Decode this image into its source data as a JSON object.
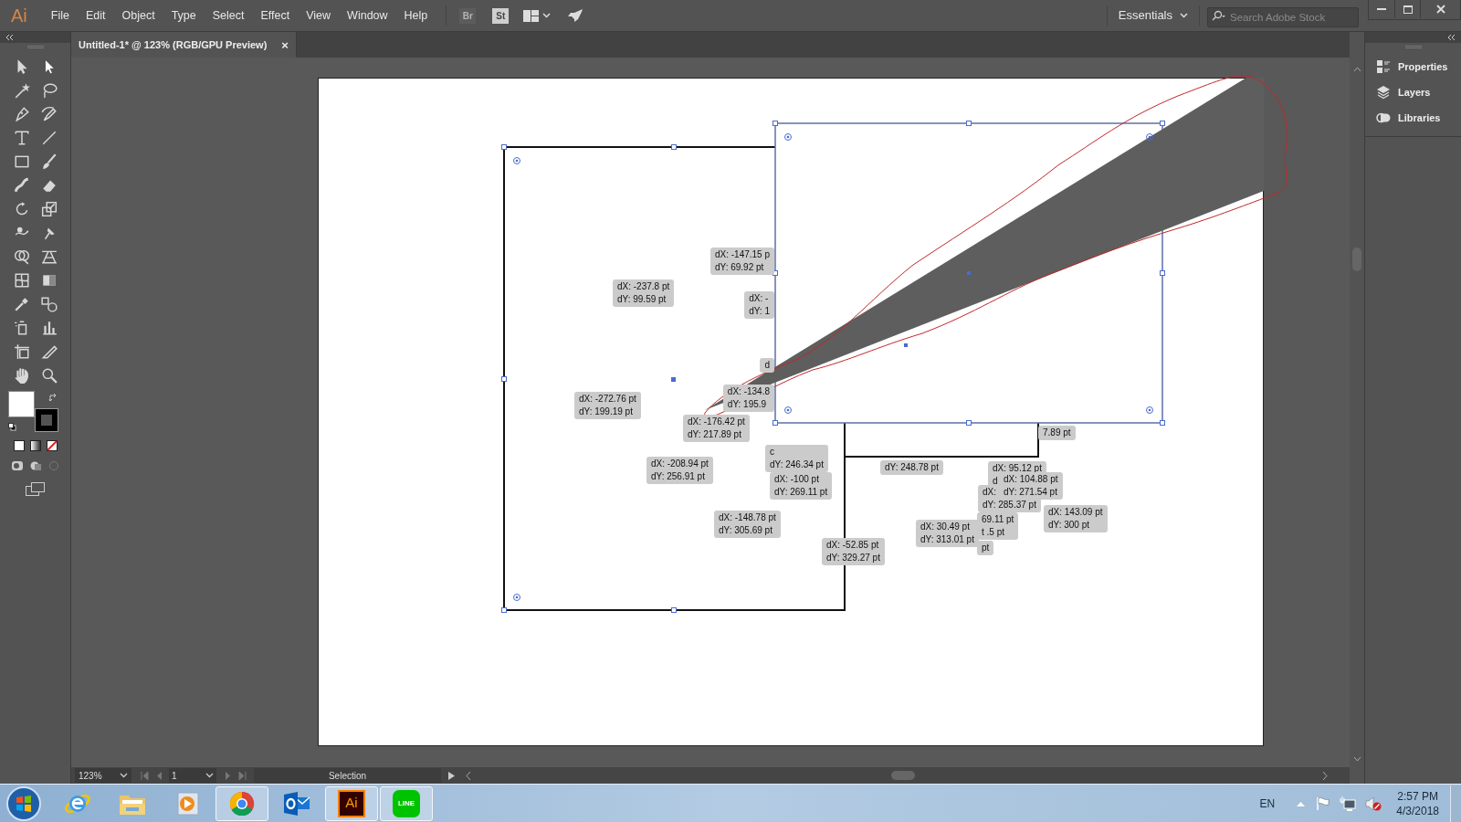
{
  "app": {
    "logo": "Ai"
  },
  "menu": [
    "File",
    "Edit",
    "Object",
    "Type",
    "Select",
    "Effect",
    "View",
    "Window",
    "Help"
  ],
  "app_buttons": [
    {
      "label": "Br",
      "disabled": true
    },
    {
      "label": "St",
      "disabled": false
    }
  ],
  "workspace": "Essentials",
  "search": {
    "placeholder": "Search Adobe Stock"
  },
  "document_tab": {
    "title": "Untitled-1* @ 123% (RGB/GPU Preview)",
    "close": "×"
  },
  "panels": [
    {
      "kind": "properties",
      "label": "Properties"
    },
    {
      "kind": "layers",
      "label": "Layers"
    },
    {
      "kind": "libraries",
      "label": "Libraries"
    }
  ],
  "tooltips": [
    {
      "lines": [
        "dX: -147.15 p",
        "dY: 69.92 pt"
      ]
    },
    {
      "lines": [
        "dX: -237.8 pt",
        "dY: 99.59 pt"
      ]
    },
    {
      "lines": [
        "dX: -",
        "dY: 1"
      ]
    },
    {
      "lines": [
        "d"
      ]
    },
    {
      "lines": [
        "dX: -272.76 pt",
        "dY: 199.19 pt"
      ]
    },
    {
      "lines": [
        "dX: -134.8",
        "dY: 195.9"
      ]
    },
    {
      "lines": [
        "dX: -176.42 pt",
        "dY: 217.89 pt"
      ]
    },
    {
      "lines": [
        "dX: -208.94 pt",
        "dY: 256.91 pt"
      ]
    },
    {
      "lines": [
        "c",
        "dY: 246.34 pt"
      ]
    },
    {
      "lines": [
        "dX: -100 pt",
        "dY: 269.11 pt"
      ]
    },
    {
      "lines": [
        "dX: -148.78 pt",
        "dY: 305.69 pt"
      ]
    },
    {
      "lines": [
        "dX: -52.85 pt",
        "dY: 329.27 pt"
      ]
    },
    {
      "lines": [
        "7.89 pt"
      ]
    },
    {
      "lines": [
        "dY: 248.78 pt"
      ]
    },
    {
      "lines": [
        "dX: 95.12 pt",
        "d"
      ]
    },
    {
      "lines": [
        "dX: 104.88 pt",
        "dY: 271.54 pt"
      ]
    },
    {
      "lines": [
        "dX:",
        "dY: 285.37 pt"
      ]
    },
    {
      "lines": [
        "dX: 143.09 pt",
        "dY: 300 pt"
      ]
    },
    {
      "lines": [
        "69.11 pt",
        "t .5 pt"
      ]
    },
    {
      "lines": [
        "pt"
      ]
    },
    {
      "lines": [
        "dX: 30.49 pt",
        "dY: 313.01 pt"
      ]
    }
  ],
  "status_bar": {
    "zoom": "123%",
    "page": "1",
    "tool": "Selection"
  },
  "taskbar": [
    {
      "kind": "ie",
      "running": false
    },
    {
      "kind": "explorer",
      "running": false
    },
    {
      "kind": "media",
      "running": false
    },
    {
      "kind": "chrome",
      "running": true
    },
    {
      "kind": "outlook",
      "running": false
    },
    {
      "kind": "illustrator",
      "label": "Ai",
      "running": true
    },
    {
      "kind": "line",
      "label": "LINE",
      "running": true
    }
  ],
  "tray": {
    "language": "EN",
    "time": "2:57 PM",
    "date": "4/3/2018"
  }
}
